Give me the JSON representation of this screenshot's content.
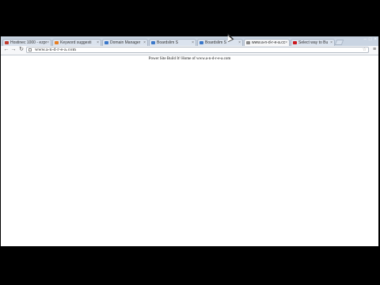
{
  "browser": {
    "tabs": [
      {
        "label": "Hostinec 1000 - ezpr",
        "active": false,
        "favicon_color": "#c0392b"
      },
      {
        "label": "Keyword suggesti",
        "active": false,
        "favicon_color": "#e67e22"
      },
      {
        "label": "Domain Manager",
        "active": false,
        "favicon_color": "#3b78c9"
      },
      {
        "label": "Boardslim S",
        "active": false,
        "favicon_color": "#3b78c9"
      },
      {
        "label": "Boardslim S",
        "active": false,
        "favicon_color": "#3b78c9"
      },
      {
        "label": "www.a-n-d-r-e-a.cc",
        "active": true,
        "favicon_color": "#8a8a8a"
      },
      {
        "label": "Select way to Bu",
        "active": false,
        "favicon_color": "#cc181e"
      }
    ],
    "address": "www.a-n-d-r-e-a.com"
  },
  "page": {
    "text": "Power Site Build It! Home of www.a-n-d-r-e-a.com"
  }
}
